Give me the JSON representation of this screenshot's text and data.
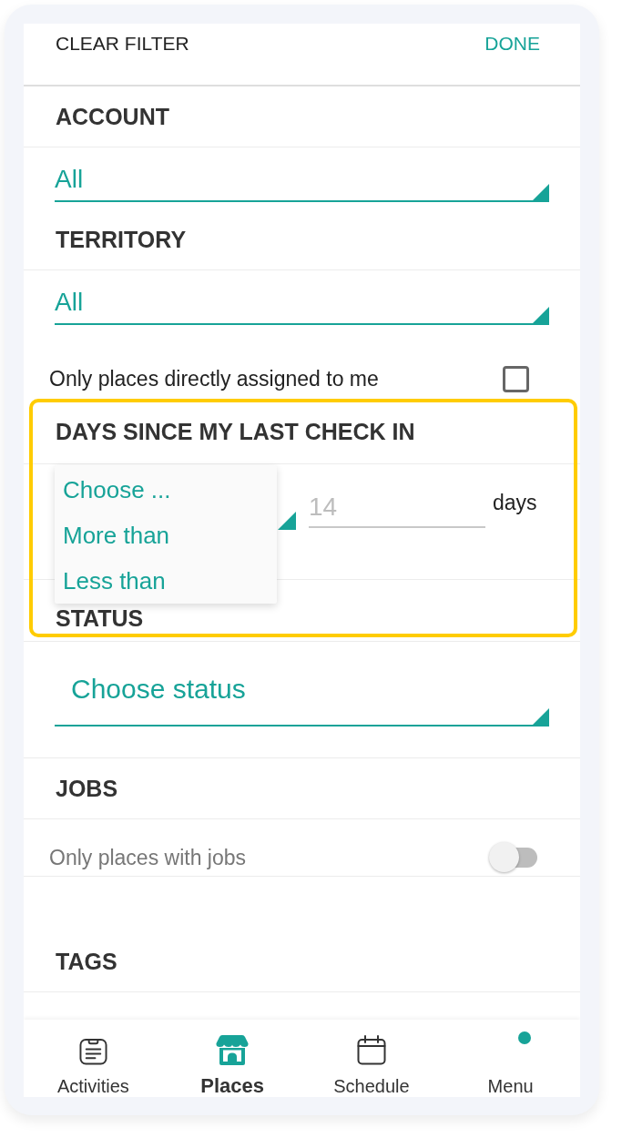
{
  "toolbar": {
    "clear": "CLEAR FILTER",
    "done": "DONE"
  },
  "account": {
    "title": "ACCOUNT",
    "value": "All"
  },
  "territory": {
    "title": "TERRITORY",
    "value": "All"
  },
  "assigned_only": {
    "label": "Only places directly assigned to me",
    "checked": false
  },
  "days_since_check_in": {
    "title": "DAYS SINCE MY LAST CHECK IN",
    "highlighted": true,
    "menu_open": true,
    "menu": [
      {
        "label": "Choose ..."
      },
      {
        "label": "More than"
      },
      {
        "label": "Less than"
      }
    ],
    "days": {
      "placeholder": "14"
    },
    "unit": "days"
  },
  "status": {
    "title": "STATUS",
    "value": "Choose status"
  },
  "jobs": {
    "title": "JOBS",
    "label": "Only places with jobs",
    "on": false
  },
  "tags": {
    "title": "TAGS"
  },
  "nav": [
    {
      "label": "Activities",
      "selected": false,
      "notification": false
    },
    {
      "label": "Places",
      "selected": true,
      "notification": false
    },
    {
      "label": "Schedule",
      "selected": false,
      "notification": false
    },
    {
      "label": "Menu",
      "selected": false,
      "notification": true
    }
  ]
}
